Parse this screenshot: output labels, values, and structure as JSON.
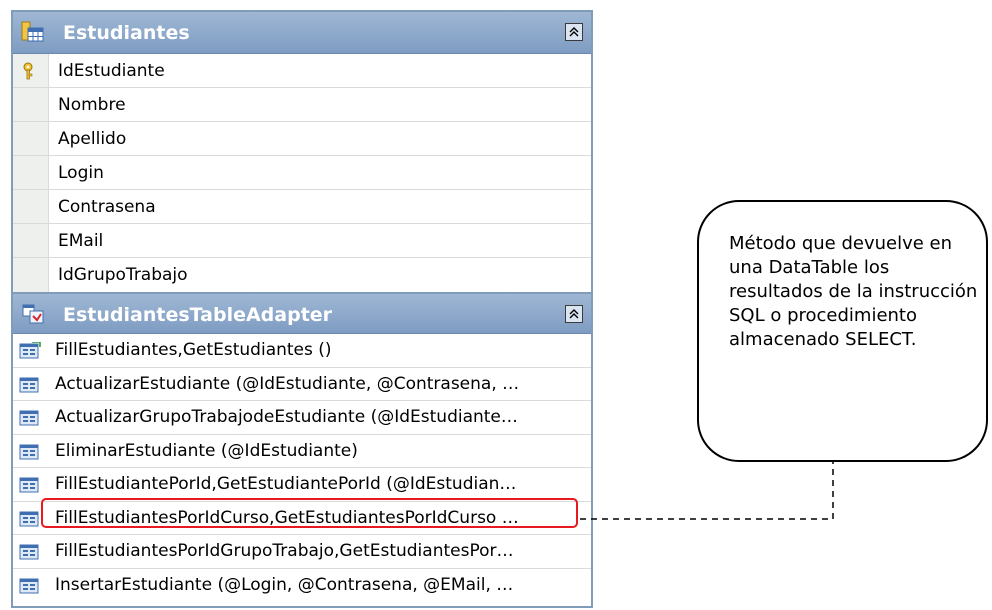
{
  "table": {
    "title": "Estudiantes",
    "columns": [
      {
        "name": "IdEstudiante",
        "key": true
      },
      {
        "name": "Nombre"
      },
      {
        "name": "Apellido"
      },
      {
        "name": "Login"
      },
      {
        "name": "Contrasena"
      },
      {
        "name": "EMail"
      },
      {
        "name": "IdGrupoTrabajo"
      }
    ]
  },
  "adapter": {
    "title": "EstudiantesTableAdapter",
    "methods": [
      {
        "label": "FillEstudiantes,GetEstudiantes ()",
        "icon": "default-query-icon"
      },
      {
        "label": "ActualizarEstudiante (@IdEstudiante, @Contrasena, …",
        "icon": "query-icon"
      },
      {
        "label": "ActualizarGrupoTrabajodeEstudiante (@IdEstudiante…",
        "icon": "query-icon"
      },
      {
        "label": "EliminarEstudiante (@IdEstudiante)",
        "icon": "query-icon"
      },
      {
        "label": "FillEstudiantePorId,GetEstudiantePorId (@IdEstudian…",
        "icon": "query-icon"
      },
      {
        "label": "FillEstudiantesPorIdCurso,GetEstudiantesPorIdCurso …",
        "icon": "query-icon",
        "highlighted": true
      },
      {
        "label": "FillEstudiantesPorIdGrupoTrabajo,GetEstudiantesPor…",
        "icon": "query-icon"
      },
      {
        "label": "InsertarEstudiante (@Login, @Contrasena, @EMail, …",
        "icon": "query-icon"
      }
    ]
  },
  "callout": {
    "text": "Método que devuelve en una DataTable los resultados de la instrucción SQL o procedimiento almacenado SELECT."
  },
  "colors": {
    "header": "#8aa6cb",
    "highlight": "#e8191f",
    "border": "#7f9db9"
  }
}
